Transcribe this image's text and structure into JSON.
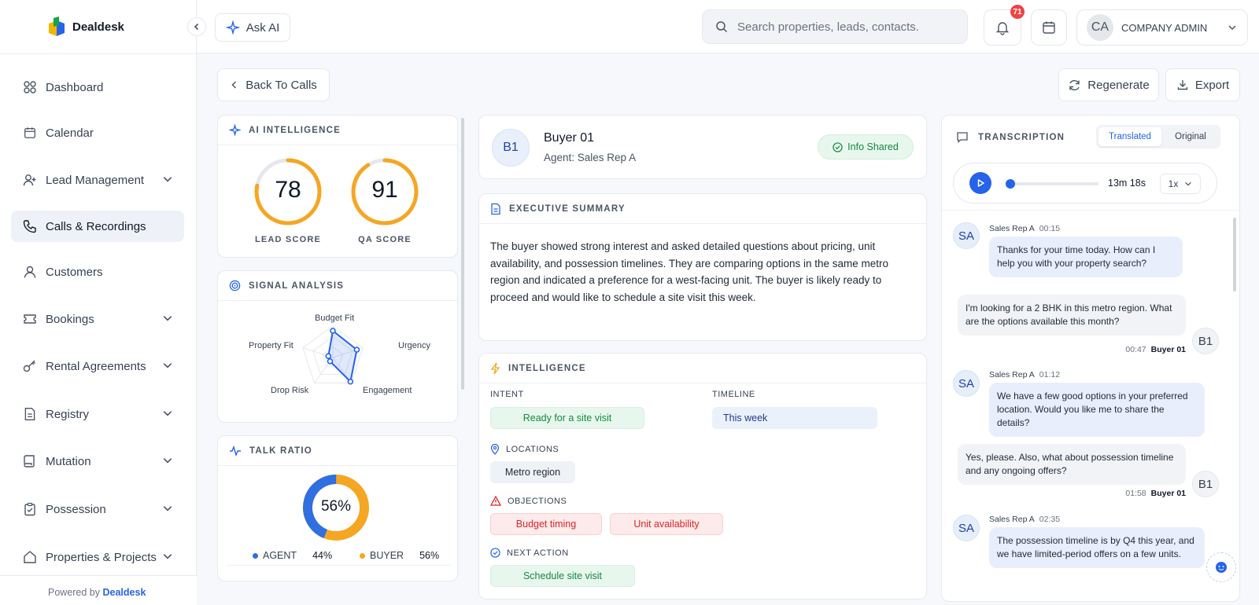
{
  "app": {
    "logo_text": "Dealdesk",
    "powered_prefix": "Powered by",
    "powered_brand": "Dealdesk"
  },
  "sidebar": {
    "items": [
      {
        "label": "Dashboard",
        "icon": "dashboard-icon",
        "has_chevron": false
      },
      {
        "label": "Calendar",
        "icon": "calendar-icon",
        "has_chevron": false
      },
      {
        "label": "Lead Management",
        "icon": "user-plus-icon",
        "has_chevron": true
      },
      {
        "label": "Calls & Recordings",
        "icon": "phone-icon",
        "has_chevron": false,
        "active": true
      },
      {
        "label": "Customers",
        "icon": "user-icon",
        "has_chevron": false
      },
      {
        "label": "Bookings",
        "icon": "ticket-icon",
        "has_chevron": true
      },
      {
        "label": "Rental Agreements",
        "icon": "key-icon",
        "has_chevron": true
      },
      {
        "label": "Registry",
        "icon": "document-icon",
        "has_chevron": true
      },
      {
        "label": "Mutation",
        "icon": "scroll-icon",
        "has_chevron": true
      },
      {
        "label": "Possession",
        "icon": "clipboard-check-icon",
        "has_chevron": true
      },
      {
        "label": "Properties & Projects",
        "icon": "home-icon",
        "has_chevron": true
      }
    ]
  },
  "topbar": {
    "ask_ai": "Ask AI",
    "search_placeholder": "Search properties, leads, contacts.",
    "notification_count": "71",
    "user_initials": "CA",
    "user_role": "COMPANY ADMIN"
  },
  "toolbar": {
    "back": "Back To Calls",
    "regenerate": "Regenerate",
    "export": "Export"
  },
  "ai_intelligence": {
    "title": "AI INTELLIGENCE",
    "lead_score": 78,
    "lead_label": "LEAD SCORE",
    "qa_score": 91,
    "qa_label": "QA SCORE"
  },
  "signal_analysis": {
    "title": "SIGNAL ANALYSIS",
    "axes": [
      "Budget Fit",
      "Urgency",
      "Engagement",
      "Drop Risk",
      "Property Fit"
    ],
    "values": [
      0.85,
      0.8,
      0.95,
      0.15,
      0.15
    ]
  },
  "talk_ratio": {
    "title": "TALK RATIO",
    "center": "56%",
    "agent_label": "AGENT",
    "agent_value": "44%",
    "agent_pct": 44,
    "buyer_label": "BUYER",
    "buyer_value": "56%",
    "buyer_pct": 56,
    "colors": {
      "agent": "#2f6fe0",
      "buyer": "#f5a623"
    }
  },
  "buyer": {
    "initials": "B1",
    "name": "Buyer 01",
    "agent": "Agent: Sales Rep A",
    "status": "Info Shared"
  },
  "summary": {
    "title": "EXECUTIVE SUMMARY",
    "text": "The buyer showed strong interest and asked detailed questions about pricing, unit availability, and possession timelines. They are comparing options in the same metro region and indicated a preference for a west-facing unit. The buyer is likely ready to proceed and would like to schedule a site visit this week."
  },
  "intelligence": {
    "title": "INTELLIGENCE",
    "intent_label": "INTENT",
    "intent": "Ready for a site visit",
    "timeline_label": "TIMELINE",
    "timeline": "This week",
    "locations_label": "LOCATIONS",
    "location": "Metro region",
    "objections_label": "OBJECTIONS",
    "objections": [
      "Budget timing",
      "Unit availability"
    ],
    "next_label": "NEXT ACTION",
    "next_action": "Schedule site visit"
  },
  "transcription": {
    "title": "TRANSCRIPTION",
    "tab_translated": "Translated",
    "tab_original": "Original",
    "duration": "13m 18s",
    "speed": "1x",
    "messages": [
      {
        "who": "SA",
        "speaker": "Sales Rep A",
        "time": "00:15",
        "text": "Thanks for your time today. How can I help you with your property search?"
      },
      {
        "who": "B1",
        "speaker": "Buyer 01",
        "time": "00:47",
        "text": "I'm looking for a 2 BHK in this metro region. What are the options available this month?"
      },
      {
        "who": "SA",
        "speaker": "Sales Rep A",
        "time": "01:12",
        "text": "We have a few good options in your preferred location. Would you like me to share the details?"
      },
      {
        "who": "B1",
        "speaker": "Buyer 01",
        "time": "01:58",
        "text": "Yes, please. Also, what about possession timeline and any ongoing offers?"
      },
      {
        "who": "SA",
        "speaker": "Sales Rep A",
        "time": "02:35",
        "text": "The possession timeline is by Q4 this year, and we have limited-period offers on a few units."
      }
    ]
  }
}
